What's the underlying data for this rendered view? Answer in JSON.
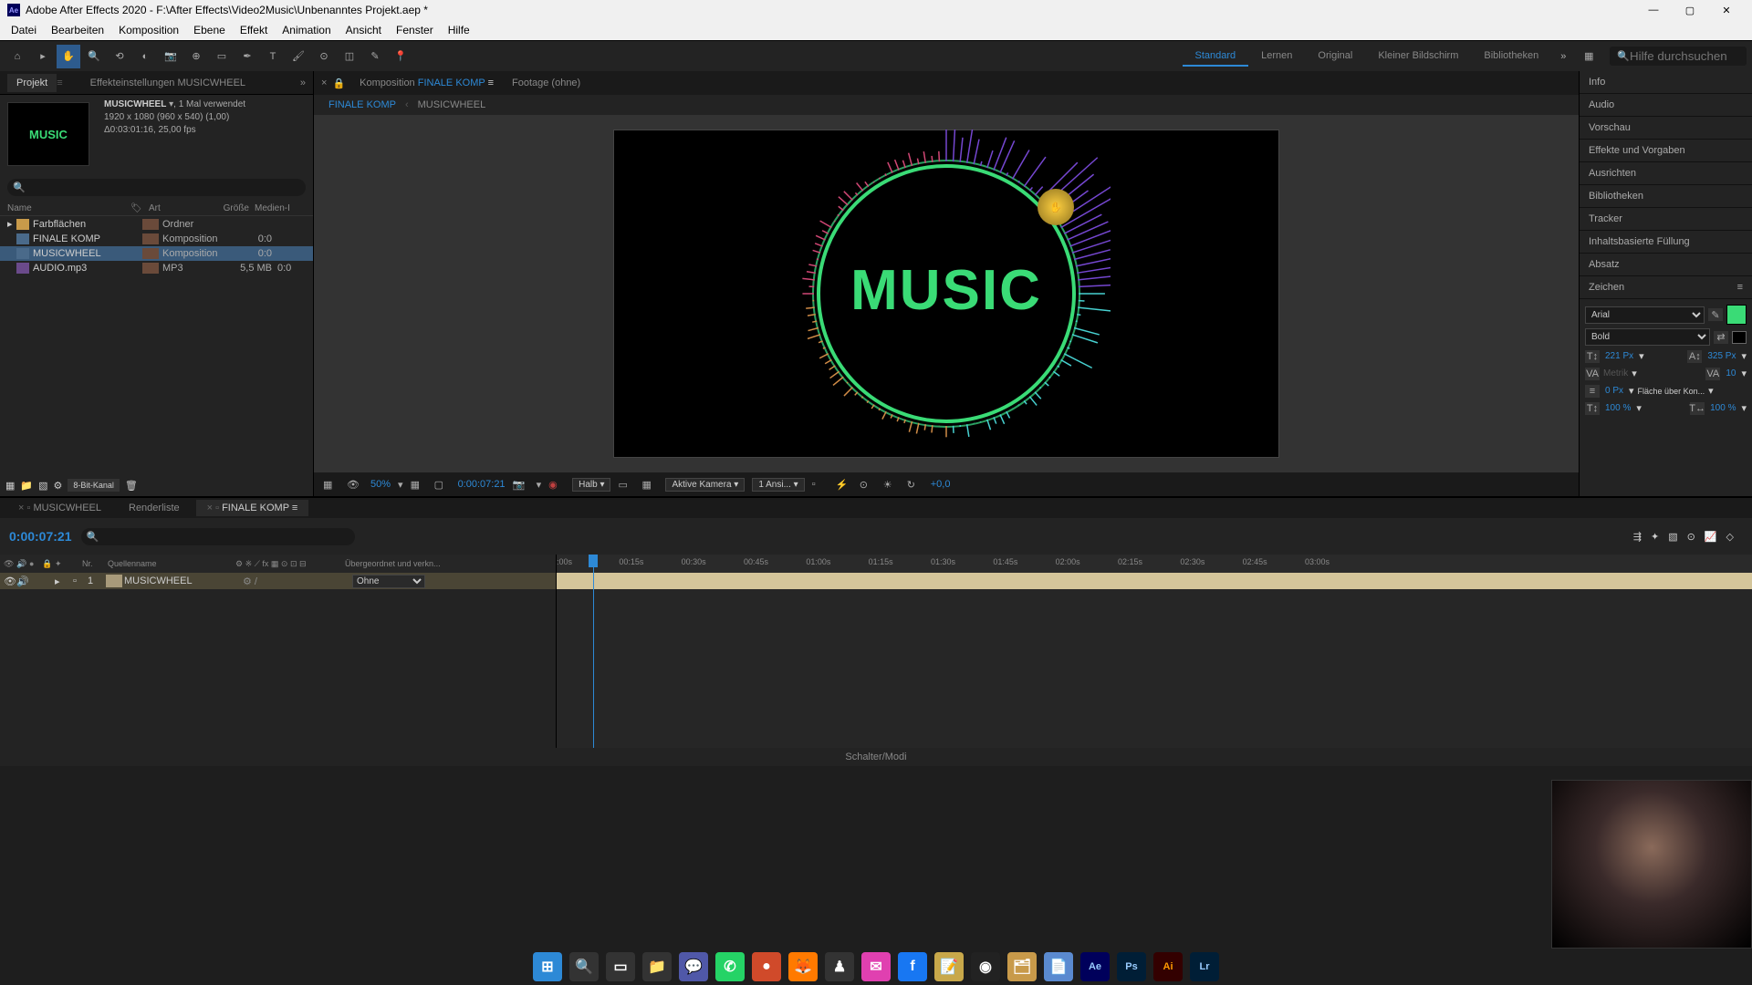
{
  "titlebar": {
    "app": "Adobe After Effects 2020",
    "path": "F:\\After Effects\\Video2Music\\Unbenanntes Projekt.aep *"
  },
  "menubar": [
    "Datei",
    "Bearbeiten",
    "Komposition",
    "Ebene",
    "Effekt",
    "Animation",
    "Ansicht",
    "Fenster",
    "Hilfe"
  ],
  "toolbar": {
    "workspaces": [
      "Standard",
      "Lernen",
      "Original",
      "Kleiner Bildschirm",
      "Bibliotheken"
    ],
    "active_workspace": "Standard",
    "search_placeholder": "Hilfe durchsuchen"
  },
  "project_panel": {
    "tabs": {
      "project": "Projekt",
      "effects": "Effekteinstellungen MUSICWHEEL"
    },
    "selected": {
      "name": "MUSICWHEEL",
      "usage": ", 1 Mal verwendet",
      "dims": "1920 x 1080 (960 x 540) (1,00)",
      "dur": "Δ0:03:01:16, 25,00 fps"
    },
    "columns": {
      "name": "Name",
      "art": "Art",
      "size": "Größe",
      "media": "Medien-I"
    },
    "items": [
      {
        "name": "Farbflächen",
        "kind": "Ordner",
        "size": "",
        "icon": "folder",
        "expandable": true
      },
      {
        "name": "FINALE KOMP",
        "kind": "Komposition",
        "size": "0:0",
        "icon": "comp"
      },
      {
        "name": "MUSICWHEEL",
        "kind": "Komposition",
        "size": "0:0",
        "icon": "comp",
        "selected": true
      },
      {
        "name": "AUDIO.mp3",
        "kind": "MP3",
        "size": "5,5 MB",
        "size2": "0:0",
        "icon": "mp3"
      }
    ],
    "footer_bits": "8-Bit-Kanal"
  },
  "comp_viewer": {
    "tab_label": "Komposition",
    "active_comp": "FINALE KOMP",
    "footage_label": "Footage (ohne)",
    "breadcrumb": [
      "FINALE KOMP",
      "MUSICWHEEL"
    ],
    "music_text": "MUSIC",
    "footer": {
      "zoom": "50%",
      "timecode": "0:00:07:21",
      "res": "Halb",
      "camera": "Aktive Kamera",
      "views": "1 Ansi...",
      "exposure": "+0,0"
    }
  },
  "right_panels": [
    "Info",
    "Audio",
    "Vorschau",
    "Effekte und Vorgaben",
    "Ausrichten",
    "Bibliotheken",
    "Tracker",
    "Inhaltsbasierte Füllung",
    "Absatz",
    "Zeichen"
  ],
  "character": {
    "font": "Arial",
    "style": "Bold",
    "size": "221 Px",
    "leading": "325 Px",
    "kerning": "Metrik",
    "tracking": "10",
    "stroke": "0 Px",
    "fill_label": "Fläche über Kon...",
    "scale_h": "100 %",
    "scale_v": "100 %",
    "fill_color": "#3adb76"
  },
  "timeline": {
    "tabs": [
      "MUSICWHEEL",
      "Renderliste",
      "FINALE KOMP"
    ],
    "active_tab": "FINALE KOMP",
    "timecode": "0:00:07:21",
    "columns": {
      "nr": "Nr.",
      "source": "Quellenname",
      "parent": "Übergeordnet und verkn..."
    },
    "layers": [
      {
        "nr": "1",
        "name": "MUSICWHEEL",
        "parent": "Ohne"
      }
    ],
    "ticks": [
      ":00s",
      "00:15s",
      "00:30s",
      "00:45s",
      "01:00s",
      "01:15s",
      "01:30s",
      "01:45s",
      "02:00s",
      "02:15s",
      "02:30s",
      "02:45s",
      "03:00s"
    ],
    "footer": "Schalter/Modi"
  },
  "taskbar": [
    {
      "name": "windows-start",
      "glyph": "⊞",
      "bg": "#2d89d6"
    },
    {
      "name": "search",
      "glyph": "🔍",
      "bg": "#333"
    },
    {
      "name": "task-view",
      "glyph": "▭",
      "bg": "#333"
    },
    {
      "name": "explorer",
      "glyph": "📁",
      "bg": "#333"
    },
    {
      "name": "app-teams",
      "glyph": "💬",
      "bg": "#5058a8"
    },
    {
      "name": "whatsapp",
      "glyph": "✆",
      "bg": "#25d366"
    },
    {
      "name": "app-red",
      "glyph": "●",
      "bg": "#d04a2a"
    },
    {
      "name": "firefox",
      "glyph": "🦊",
      "bg": "#ff7a00"
    },
    {
      "name": "app-chess",
      "glyph": "♟",
      "bg": "#333"
    },
    {
      "name": "messenger",
      "glyph": "✉",
      "bg": "#e040b0"
    },
    {
      "name": "facebook",
      "glyph": "f",
      "bg": "#1877f2"
    },
    {
      "name": "notes",
      "glyph": "📝",
      "bg": "#c8a84a"
    },
    {
      "name": "obs",
      "glyph": "◉",
      "bg": "#222"
    },
    {
      "name": "files",
      "glyph": "🗂",
      "bg": "#c89a4a"
    },
    {
      "name": "notepad",
      "glyph": "📄",
      "bg": "#5a8ad0"
    },
    {
      "name": "after-effects",
      "glyph": "Ae",
      "bg": "#00005b"
    },
    {
      "name": "photoshop",
      "glyph": "Ps",
      "bg": "#001e36"
    },
    {
      "name": "illustrator",
      "glyph": "Ai",
      "bg": "#330000"
    },
    {
      "name": "lightroom",
      "glyph": "Lr",
      "bg": "#001e36"
    }
  ]
}
